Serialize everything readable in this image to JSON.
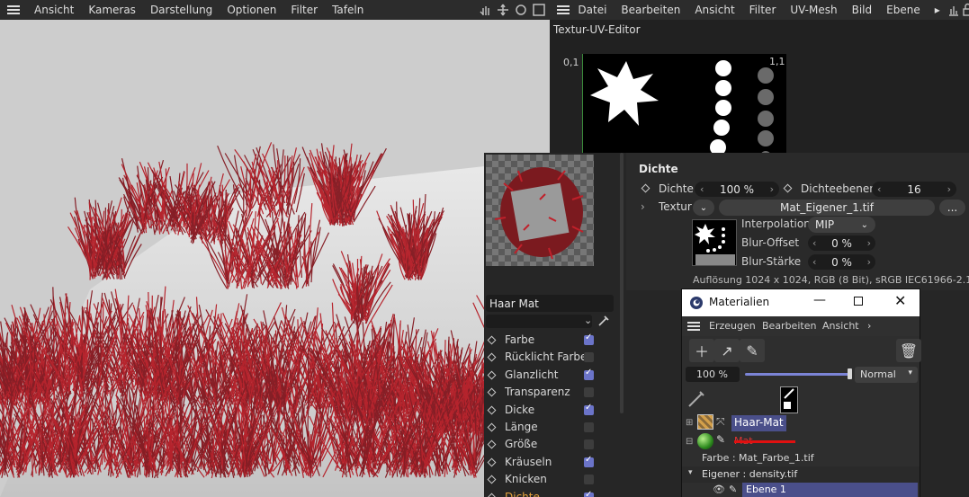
{
  "viewport_menu": [
    "Ansicht",
    "Kameras",
    "Darstellung",
    "Optionen",
    "Filter",
    "Tafeln"
  ],
  "uv_menu": [
    "Datei",
    "Bearbeiten",
    "Ansicht",
    "Filter",
    "UV-Mesh",
    "Bild",
    "Ebene"
  ],
  "uv_editor": {
    "title": "Textur-UV-Editor",
    "corner_tl": "0,1",
    "corner_tr": "1,1"
  },
  "attributes": {
    "section": "Dichte",
    "dichte_label": "Dichte",
    "dichte_value": "100 %",
    "ebenen_label": "Dichteebenen",
    "ebenen_value": "16",
    "textur_label": "Textur",
    "textur_file": "Mat_Eigener_1.tif",
    "more_button": "...",
    "interpolation_label": "Interpolation",
    "interpolation_value": "MIP",
    "blur_offset_label": "Blur-Offset",
    "blur_offset_value": "0 %",
    "blur_staerke_label": "Blur-Stärke",
    "blur_staerke_value": "0 %",
    "resolution": "Auflösung 1024 x 1024, RGB (8 Bit), sRGB IEC61966-2.1"
  },
  "material_editor": {
    "name": "Haar Mat",
    "channels": [
      {
        "label": "Farbe",
        "checked": true
      },
      {
        "label": "Rücklicht Farbe",
        "checked": false
      },
      {
        "label": "Glanzlicht",
        "checked": true
      },
      {
        "label": "Transparenz",
        "checked": false
      },
      {
        "label": "Dicke",
        "checked": true
      },
      {
        "label": "Länge",
        "checked": false
      },
      {
        "label": "Größe",
        "checked": false
      },
      {
        "label": "Kräuseln",
        "checked": true
      },
      {
        "label": "Knicken",
        "checked": false
      },
      {
        "label": "Dichte",
        "checked": true
      }
    ]
  },
  "materials_window": {
    "title": "Materialien",
    "menu": [
      "Erzeugen",
      "Bearbeiten",
      "Ansicht"
    ],
    "zoom": "100 %",
    "blend_mode": "Normal",
    "items": [
      {
        "name": "Haar-Mat"
      },
      {
        "name": "Mat"
      }
    ],
    "farbe_line": "Farbe : Mat_Farbe_1.tif",
    "eigener_line": "Eigener : density.tif",
    "layer_name": "Ebene 1"
  },
  "colors": {
    "accent_orange": "#e8a33c",
    "check_blue": "#6b74c9",
    "hair_red": "#b3121c",
    "selected_row": "#4a4f8a"
  }
}
